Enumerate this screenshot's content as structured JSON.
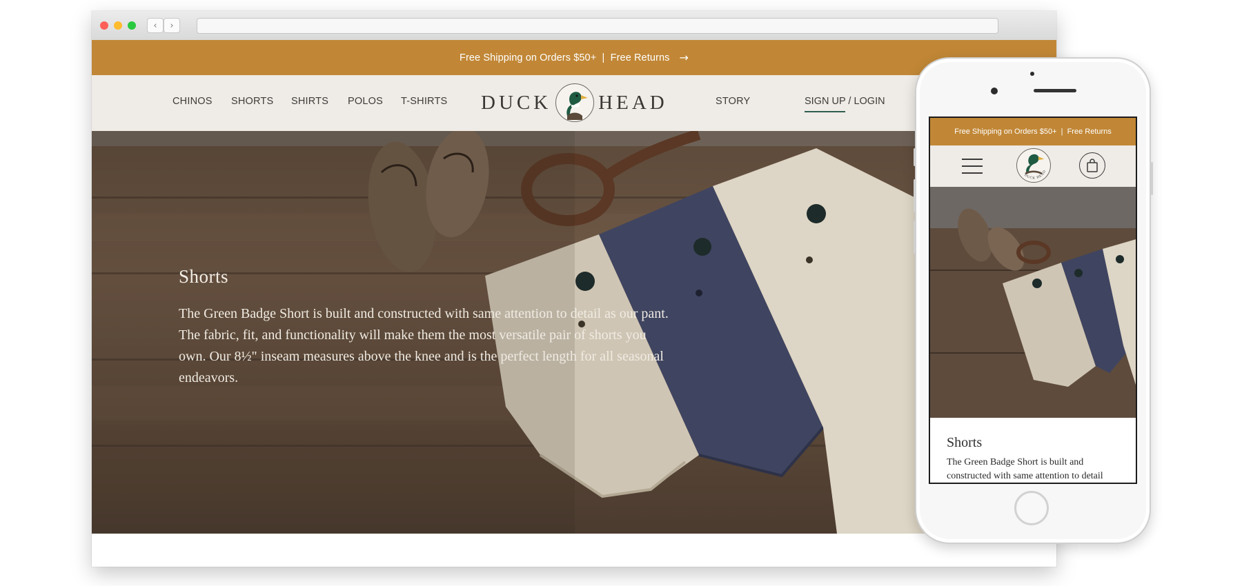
{
  "desktop": {
    "promo": {
      "text": "Free Shipping on Orders $50+  |  Free Returns",
      "arrow": "→"
    },
    "nav": {
      "links": [
        "CHINOS",
        "SHORTS",
        "SHIRTS",
        "POLOS",
        "T-SHIRTS"
      ],
      "story": "STORY",
      "signup": "SIGN UP",
      "separator": " / ",
      "login": "LOGIN"
    },
    "logo": {
      "left": "DUCK",
      "right": "HEAD"
    },
    "hero": {
      "title": "Shorts",
      "body": "The Green Badge Short is built and constructed with same attention to detail as our pant. The fabric, fit, and functionality will make them the most versatile pair of shorts you own. Our 8½\" inseam measures above the knee and is the perfect length for all seasonal endeavors."
    }
  },
  "mobile": {
    "promo": {
      "text": "Free Shipping on Orders $50+  |  Free Returns"
    },
    "logo_text": "DUCK HEAD",
    "title": "Shorts",
    "body": "The Green Badge Short is built and constructed with same attention to detail"
  },
  "icons": [
    "back-arrow-icon",
    "forward-arrow-icon",
    "arrow-right-icon",
    "duck-logo-icon",
    "hamburger-menu-icon",
    "shopping-bag-icon"
  ],
  "colors": {
    "promo": "#c18736",
    "nav_bg": "#efebe6",
    "accent_underline": "#2f5d4f",
    "text_dark": "#3c3c3a"
  }
}
